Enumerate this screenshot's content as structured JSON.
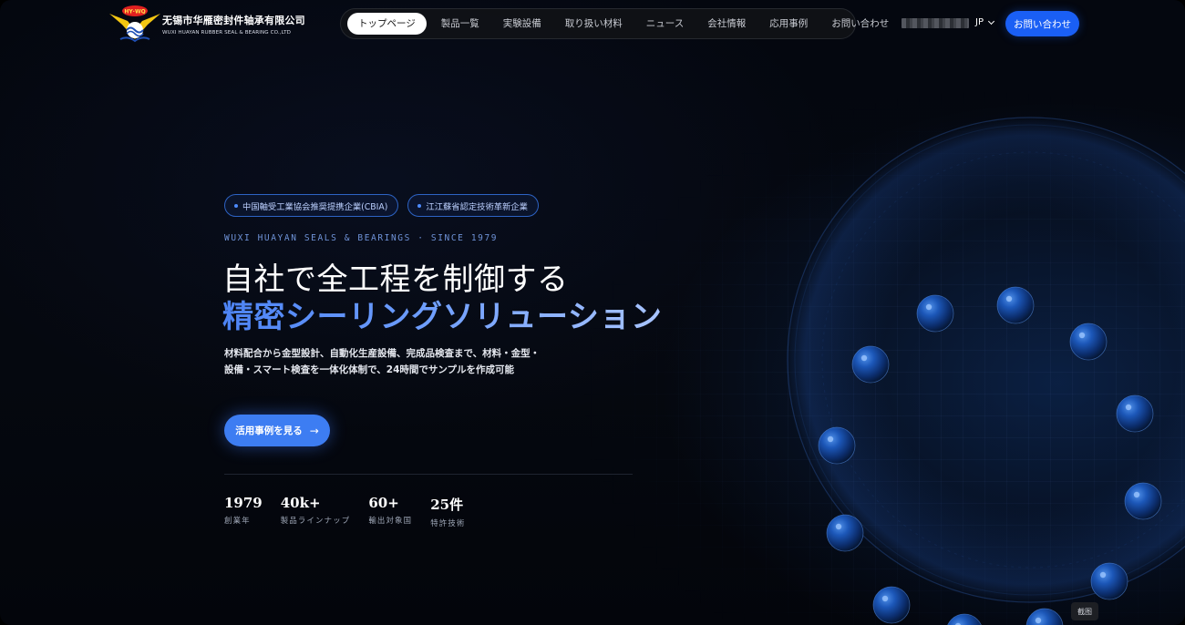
{
  "header": {
    "logo_text": "HY·WQ",
    "brand_cn": "无锡市华雁密封件轴承有限公司",
    "brand_en": "WUXI HUAYAN RUBBER SEAL & BEARING CO.,LTD",
    "nav": [
      {
        "label": "トップページ",
        "active": true
      },
      {
        "label": "製品一覧",
        "active": false
      },
      {
        "label": "実験設備",
        "active": false
      },
      {
        "label": "取り扱い材料",
        "active": false
      },
      {
        "label": "ニュース",
        "active": false
      },
      {
        "label": "会社情報",
        "active": false
      },
      {
        "label": "応用事例",
        "active": false
      },
      {
        "label": "お問い合わせ",
        "active": false
      }
    ],
    "language": "JP",
    "cta_label": "お問い合わせ"
  },
  "hero": {
    "badges": [
      "中国軸受工業協会推奨提携企業(CBIA)",
      "江江蘇省認定技術革新企業"
    ],
    "eyebrow": "WUXI HUAYAN SEALS & BEARINGS · SINCE 1979",
    "title_line1": "自社で全工程を制御する",
    "title_line2": "精密シーリングソリューション",
    "description": "材料配合から金型設計、自動化生産設備、完成品検査まで、材料・金型・設備・スマート検査を一体化体制で、24時間でサンプルを作成可能",
    "cta_label": "活用事例を見る",
    "cta_arrow": "→"
  },
  "stats": [
    {
      "value": "1979",
      "label": "創業年"
    },
    {
      "value": "40k+",
      "label": "製品ラインナップ"
    },
    {
      "value": "60+",
      "label": "輸出対象国"
    },
    {
      "value": "25件",
      "label": "特許技術"
    }
  ],
  "overlay": {
    "screenshot_label": "截图"
  },
  "colors": {
    "accent": "#1a5ff5",
    "hero_cta": "#3d7df2",
    "badge_border": "#2d63c4",
    "background": "#04070f"
  }
}
